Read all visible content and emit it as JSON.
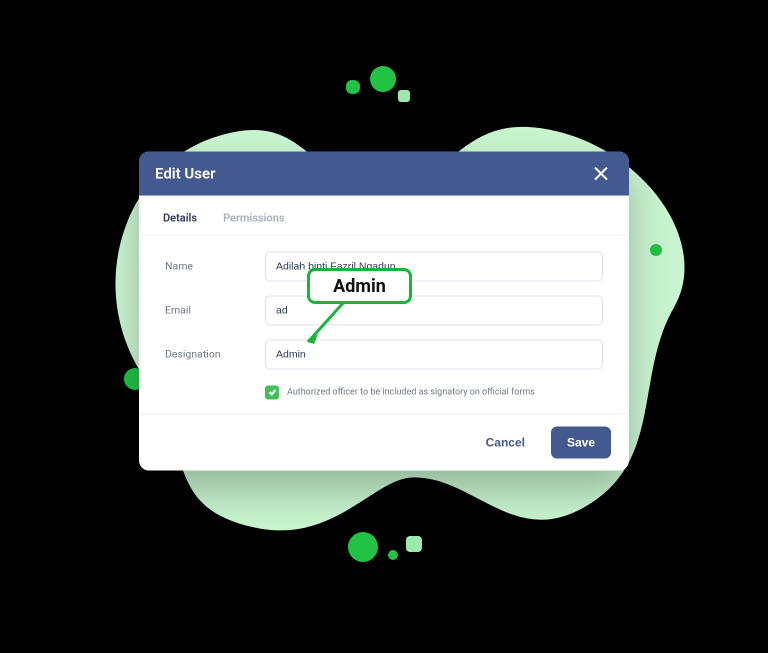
{
  "modal": {
    "title": "Edit User",
    "close_icon": "close"
  },
  "tabs": {
    "details": "Details",
    "permissions": "Permissions"
  },
  "form": {
    "name_label": "Name",
    "name_value": "Adilah binti Fazril Ngadun",
    "email_label": "Email",
    "email_value": "ad",
    "designation_label": "Designation",
    "designation_value": "Admin",
    "checkbox_label": "Authorized officer to be included as signatory on official forms"
  },
  "footer": {
    "cancel_label": "Cancel",
    "save_label": "Save"
  },
  "callout": {
    "text": "Admin"
  },
  "colors": {
    "header": "#44598f",
    "accent_green": "#3fbf55",
    "blob_green": "#c8f4cf"
  }
}
